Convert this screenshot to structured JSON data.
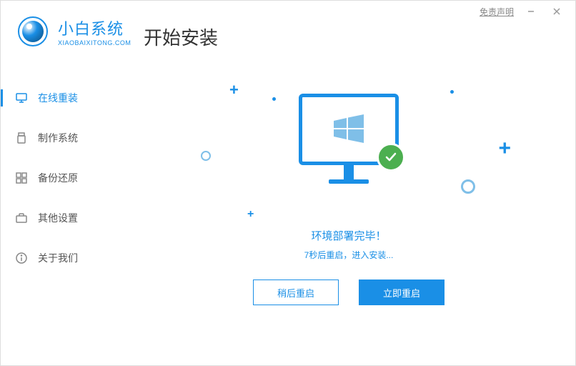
{
  "window": {
    "disclaimer": "免责声明"
  },
  "brand": {
    "cn": "小白系统",
    "en": "XIAOBAIXITONG.COM"
  },
  "page_title": "开始安装",
  "sidebar": {
    "items": [
      {
        "label": "在线重装",
        "icon": "monitor-icon",
        "active": true
      },
      {
        "label": "制作系统",
        "icon": "usb-icon",
        "active": false
      },
      {
        "label": "备份还原",
        "icon": "grid-icon",
        "active": false
      },
      {
        "label": "其他设置",
        "icon": "briefcase-icon",
        "active": false
      },
      {
        "label": "关于我们",
        "icon": "info-icon",
        "active": false
      }
    ]
  },
  "status": {
    "title": "环境部署完毕！",
    "subtitle": "7秒后重启，进入安装..."
  },
  "actions": {
    "later": "稍后重启",
    "now": "立即重启"
  },
  "colors": {
    "accent": "#1a8fe6",
    "success": "#4caf50"
  }
}
